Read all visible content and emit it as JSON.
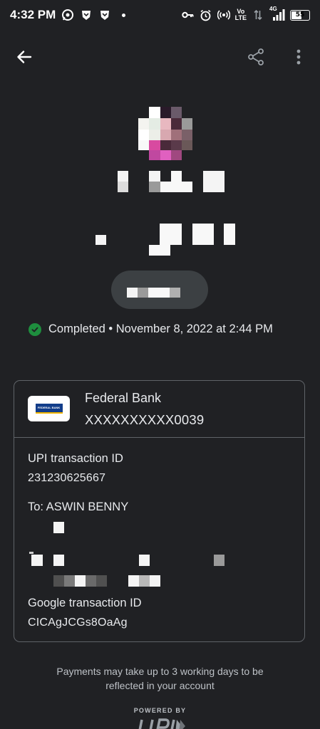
{
  "status_bar": {
    "time": "4:32 PM",
    "left_icons": [
      "whatsapp-icon",
      "brave-icon",
      "brave-icon",
      "dot-icon"
    ],
    "right_icons": [
      "key-icon",
      "alarm-icon",
      "hotspot-icon",
      "volte-icon",
      "data-arrows-icon",
      "signal-4g-icon"
    ],
    "volte_text_top": "Vo",
    "volte_text_bottom": "LTE",
    "network": "4G",
    "battery": "55"
  },
  "app_bar": {
    "back_icon": "arrow-back-icon",
    "share_icon": "share-icon",
    "more_icon": "more-vert-icon"
  },
  "transaction": {
    "status": "Completed",
    "separator": "•",
    "datetime": "November 8, 2022 at 2:44 PM"
  },
  "bank": {
    "name": "Federal Bank",
    "account": "XXXXXXXXXX0039",
    "logo_text": "FEDERAL BANK"
  },
  "details": {
    "upi_label": "UPI transaction ID",
    "upi_value": "231230625667",
    "to_label": "To: ASWIN BENNY",
    "google_label": "Google transaction ID",
    "google_value": "CICAgJCGs8OaAg"
  },
  "footer": {
    "note_line1": "Payments may take up to 3 working days to be",
    "note_line2": "reflected in your account",
    "powered_by": "POWERED BY"
  },
  "colors": {
    "background": "#202124",
    "text": "#e8eaed",
    "border": "#5f6368",
    "success": "#1e8e3e"
  }
}
